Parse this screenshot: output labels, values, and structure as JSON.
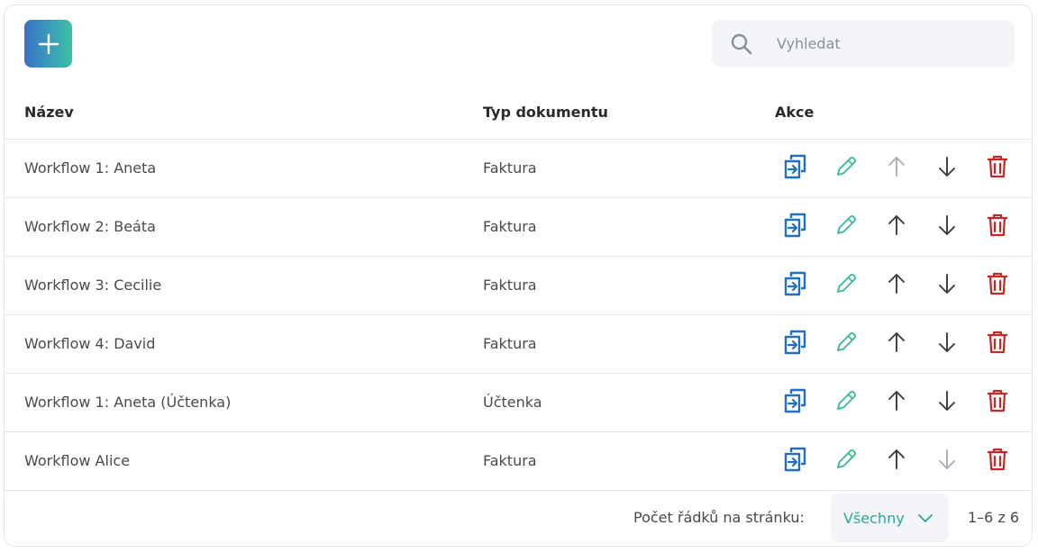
{
  "toolbar": {
    "add_icon": "plus-icon",
    "search_placeholder": "Vyhledat",
    "search_value": ""
  },
  "table": {
    "headers": {
      "name": "Název",
      "type": "Typ dokumentu",
      "actions": "Akce"
    },
    "rows": [
      {
        "name": "Workflow 1: Aneta",
        "type": "Faktura",
        "up_enabled": false,
        "down_enabled": true
      },
      {
        "name": "Workflow 2: Beáta",
        "type": "Faktura",
        "up_enabled": true,
        "down_enabled": true
      },
      {
        "name": "Workflow 3: Cecilie",
        "type": "Faktura",
        "up_enabled": true,
        "down_enabled": true
      },
      {
        "name": "Workflow 4: David",
        "type": "Faktura",
        "up_enabled": true,
        "down_enabled": true
      },
      {
        "name": "Workflow 1: Aneta (Účtenka)",
        "type": "Účtenka",
        "up_enabled": true,
        "down_enabled": true
      },
      {
        "name": "Workflow Alice",
        "type": "Faktura",
        "up_enabled": true,
        "down_enabled": false
      }
    ]
  },
  "footer": {
    "rows_per_page_label": "Počet řádků na stránku:",
    "rows_per_page_value": "Všechny",
    "range_text": "1–6 z 6"
  },
  "colors": {
    "copy": "#1f6fc5",
    "edit": "#3cb89a",
    "arrow_enabled": "#3a3a3a",
    "arrow_disabled": "#a9adb3",
    "delete": "#c62828",
    "accent": "#2fa597"
  }
}
